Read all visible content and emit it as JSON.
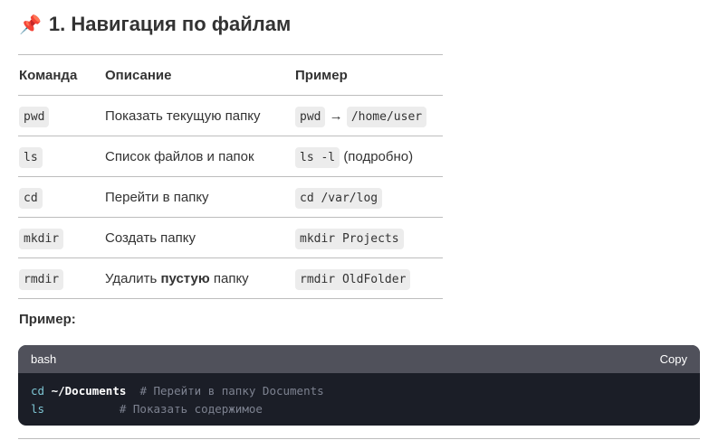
{
  "heading": {
    "icon": "pushpin-icon",
    "text": "1. Навигация по файлам"
  },
  "table": {
    "headers": [
      "Команда",
      "Описание",
      "Пример"
    ],
    "rows": [
      {
        "cmd": "pwd",
        "desc": "Показать текущую папку",
        "ex1": "pwd",
        "sep": "→",
        "ex2": "/home/user"
      },
      {
        "cmd": "ls",
        "desc": "Список файлов и папок",
        "ex1": "ls -l",
        "note": "(подробно)"
      },
      {
        "cmd": "cd",
        "desc": "Перейти в папку",
        "ex1": "cd /var/log"
      },
      {
        "cmd": "mkdir",
        "desc": "Создать папку",
        "ex1": "mkdir Projects"
      },
      {
        "cmd": "rmdir",
        "desc_pre": "Удалить ",
        "desc_bold": "пустую",
        "desc_post": " папку",
        "ex1": "rmdir OldFolder"
      }
    ]
  },
  "example_label": "Пример:",
  "code": {
    "lang": "bash",
    "copy": "Copy",
    "line1": {
      "cmd": "cd",
      "arg": "~/Documents",
      "pad": "  ",
      "comment": "# Перейти в папку Documents"
    },
    "line2": {
      "cmd": "ls",
      "pad": "           ",
      "comment": "# Показать содержимое"
    }
  }
}
